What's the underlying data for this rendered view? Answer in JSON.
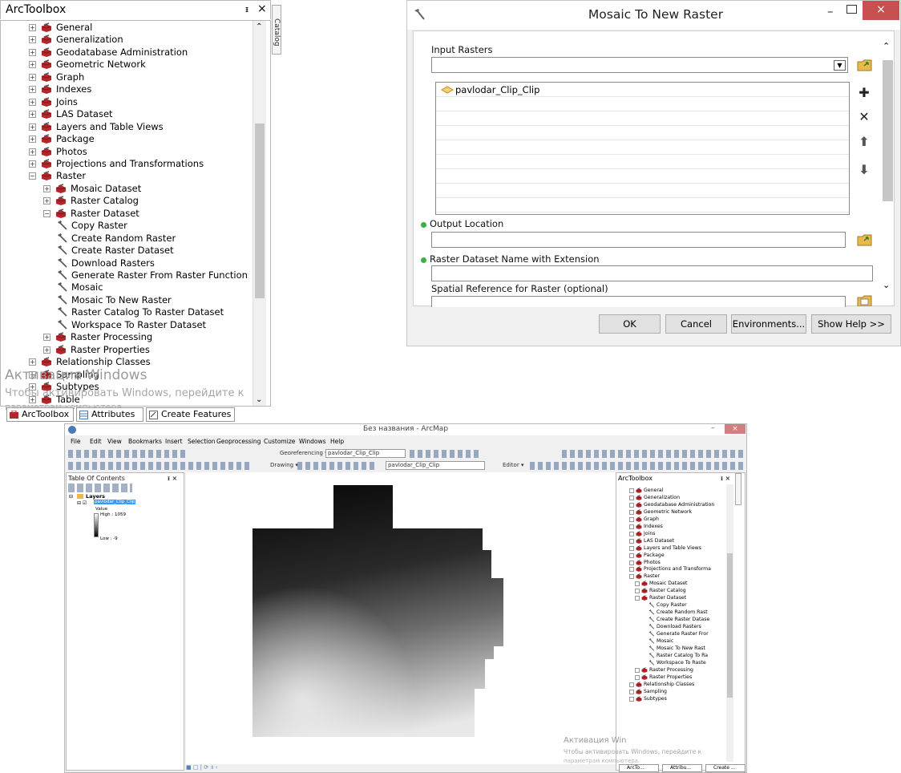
{
  "toolbox": {
    "title": "ArcToolbox",
    "pin": "ᵻ",
    "close": "×",
    "catalog_tab": "Catalog",
    "items": [
      {
        "label": "General",
        "kind": "box",
        "level": 0,
        "ex": "+"
      },
      {
        "label": "Generalization",
        "kind": "box",
        "level": 0,
        "ex": "+"
      },
      {
        "label": "Geodatabase Administration",
        "kind": "box",
        "level": 0,
        "ex": "+"
      },
      {
        "label": "Geometric Network",
        "kind": "box",
        "level": 0,
        "ex": "+"
      },
      {
        "label": "Graph",
        "kind": "box",
        "level": 0,
        "ex": "+"
      },
      {
        "label": "Indexes",
        "kind": "box",
        "level": 0,
        "ex": "+"
      },
      {
        "label": "Joins",
        "kind": "box",
        "level": 0,
        "ex": "+"
      },
      {
        "label": "LAS Dataset",
        "kind": "box",
        "level": 0,
        "ex": "+"
      },
      {
        "label": "Layers and Table Views",
        "kind": "box",
        "level": 0,
        "ex": "+"
      },
      {
        "label": "Package",
        "kind": "box",
        "level": 0,
        "ex": "+"
      },
      {
        "label": "Photos",
        "kind": "box",
        "level": 0,
        "ex": "+"
      },
      {
        "label": "Projections and Transformations",
        "kind": "box",
        "level": 0,
        "ex": "+"
      },
      {
        "label": "Raster",
        "kind": "box",
        "level": 0,
        "ex": "−"
      },
      {
        "label": "Mosaic Dataset",
        "kind": "box",
        "level": 1,
        "ex": "+"
      },
      {
        "label": "Raster Catalog",
        "kind": "box",
        "level": 1,
        "ex": "+"
      },
      {
        "label": "Raster Dataset",
        "kind": "box",
        "level": 1,
        "ex": "−"
      },
      {
        "label": "Copy Raster",
        "kind": "tool",
        "level": 2
      },
      {
        "label": "Create Random Raster",
        "kind": "tool",
        "level": 2
      },
      {
        "label": "Create Raster Dataset",
        "kind": "tool",
        "level": 2
      },
      {
        "label": "Download Rasters",
        "kind": "tool",
        "level": 2
      },
      {
        "label": "Generate Raster From Raster Function",
        "kind": "tool",
        "level": 2
      },
      {
        "label": "Mosaic",
        "kind": "tool",
        "level": 2
      },
      {
        "label": "Mosaic To New Raster",
        "kind": "tool",
        "level": 2
      },
      {
        "label": "Raster Catalog To Raster Dataset",
        "kind": "tool",
        "level": 2
      },
      {
        "label": "Workspace To Raster Dataset",
        "kind": "tool",
        "level": 2
      },
      {
        "label": "Raster Processing",
        "kind": "box",
        "level": 1,
        "ex": "+"
      },
      {
        "label": "Raster Properties",
        "kind": "box",
        "level": 1,
        "ex": "+"
      },
      {
        "label": "Relationship Classes",
        "kind": "box",
        "level": 0,
        "ex": "+"
      },
      {
        "label": "Sampling",
        "kind": "box",
        "level": 0,
        "ex": "+"
      },
      {
        "label": "Subtypes",
        "kind": "box",
        "level": 0,
        "ex": "+"
      },
      {
        "label": "Table",
        "kind": "box",
        "level": 0,
        "ex": "+"
      }
    ],
    "watermark_line1": "Активация Windows",
    "watermark_line2": "Чтобы активировать Windows, перейдите к",
    "watermark_line3": "параметрам компьютера.",
    "tabs": [
      "ArcToolbox",
      "Attributes",
      "Create Features"
    ],
    "colors": {
      "toolbox_icon": "#b3262b",
      "border": "#b8b8b8"
    }
  },
  "dialog": {
    "title": "Mosaic To New Raster",
    "min": "–",
    "close": "×",
    "input_rasters_label": "Input Rasters",
    "input_rasters_value": "",
    "list_items": [
      "pavlodar_Clip_Clip"
    ],
    "output_location_label": "Output Location",
    "output_location_value": "",
    "dataset_name_label": "Raster Dataset Name with Extension",
    "dataset_name_value": "",
    "spatial_ref_label": "Spatial Reference for Raster (optional)",
    "buttons": {
      "ok": "OK",
      "cancel": "Cancel",
      "env": "Environments...",
      "help": "Show Help >>"
    },
    "colors": {
      "required_dot": "#3cb043",
      "close_bg": "#c75050",
      "folder": "#e9b949"
    }
  },
  "arcmap": {
    "title": "Без названия - ArcMap",
    "min": "–",
    "close": "×",
    "menu": [
      "File",
      "Edit",
      "View",
      "Bookmarks",
      "Insert",
      "Selection",
      "Geoprocessing",
      "Customize",
      "Windows",
      "Help"
    ],
    "toolbar": {
      "georef": "Georeferencing ▾",
      "layer_dd": "pavlodar_Clip_Clip",
      "drawing": "Drawing ▾",
      "layer_dd2": "pavlodar_Clip_Clip",
      "editor": "Editor ▾"
    },
    "toc": {
      "title": "Table Of Contents",
      "layers": "Layers",
      "layer_name": "pavlodar_Clip_Clip",
      "value": "Value",
      "high": "High : 1059",
      "low": "Low : -9"
    },
    "toolbox_title": "ArcToolbox",
    "toolbox_items": [
      "General",
      "Generalization",
      "Geodatabase Administration",
      "Geometric Network",
      "Graph",
      "Indexes",
      "Joins",
      "LAS Dataset",
      "Layers and Table Views",
      "Package",
      "Photos",
      "Projections and Transforma",
      "Raster",
      "Mosaic Dataset",
      "Raster Catalog",
      "Raster Dataset",
      "Copy Raster",
      "Create Random Rast",
      "Create Raster Datase",
      "Download Rasters",
      "Generate Raster Fror",
      "Mosaic",
      "Mosaic To New Rast",
      "Raster Catalog To Ra",
      "Workspace To Raste",
      "Raster Processing",
      "Raster Properties",
      "Relationship Classes",
      "Sampling",
      "Subtypes"
    ],
    "toolbox_levels": [
      0,
      0,
      0,
      0,
      0,
      0,
      0,
      0,
      0,
      0,
      0,
      0,
      0,
      1,
      1,
      1,
      2,
      2,
      2,
      2,
      2,
      2,
      2,
      2,
      2,
      1,
      1,
      0,
      0,
      0
    ],
    "watermark_line1": "Активация Win",
    "watermark_line2": "Чтобы активировать Windows, перейдите к",
    "watermark_line3": "параметрам компьютера.",
    "tabs": [
      "ArcTo...",
      "Attribu...",
      "Create ..."
    ]
  }
}
